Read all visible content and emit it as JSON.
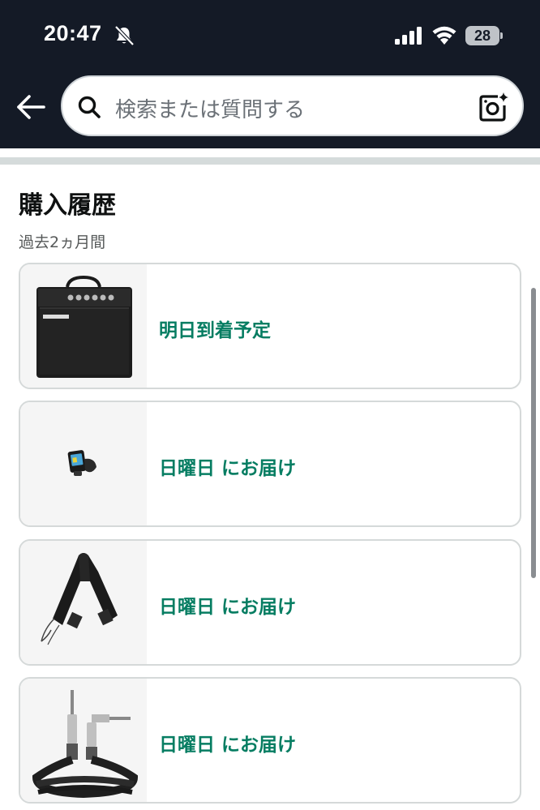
{
  "status_bar": {
    "time": "20:47",
    "battery_level": "28",
    "icons": [
      "bell-slash-icon",
      "cellular-signal-icon",
      "wifi-icon",
      "battery-icon"
    ]
  },
  "header": {
    "search_placeholder": "検索または質問する",
    "icons": [
      "back-arrow-icon",
      "search-icon",
      "camera-sparkle-icon"
    ],
    "background_color": "#141a26"
  },
  "purchase_history": {
    "title": "購入履歴",
    "subtitle": "過去2ヵ月間",
    "accent_color": "#067d62",
    "items": [
      {
        "status": "明日到着予定",
        "image": "guitar-amplifier"
      },
      {
        "status": "日曜日 にお届け",
        "image": "clip-on-tuner"
      },
      {
        "status": "日曜日 にお届け",
        "image": "guitar-strap"
      },
      {
        "status": "日曜日 にお届け",
        "image": "instrument-cable"
      }
    ]
  }
}
